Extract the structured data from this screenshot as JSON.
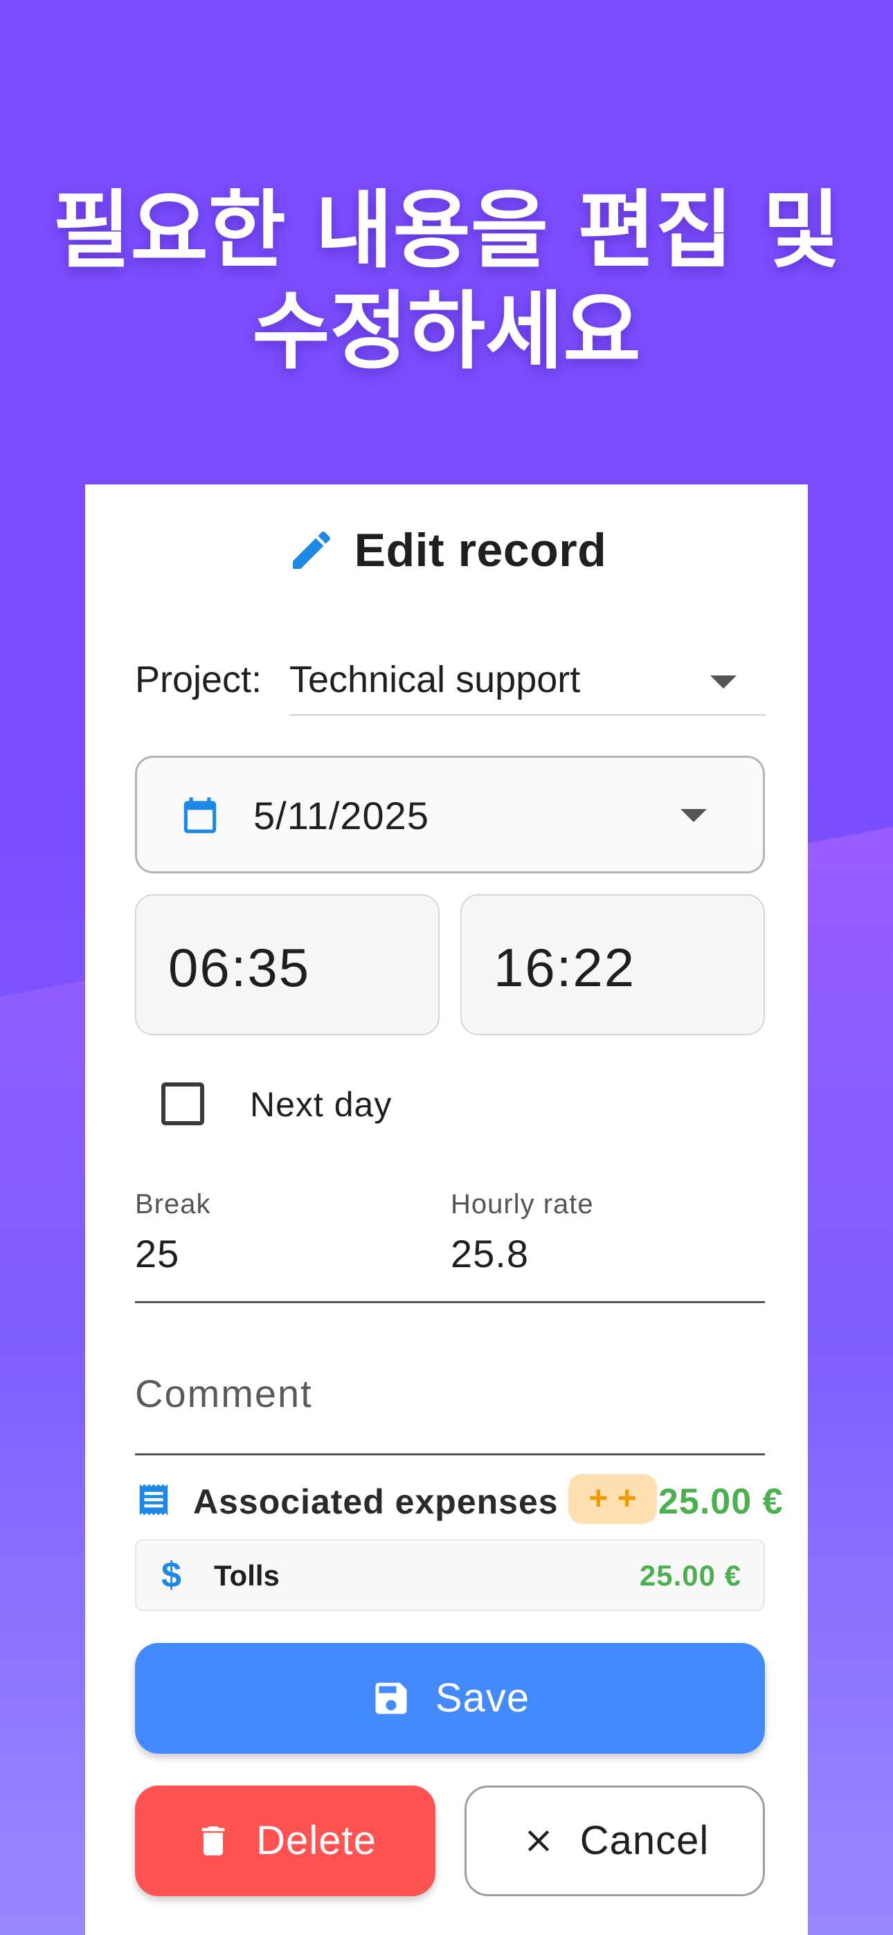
{
  "headline": {
    "line1": "필요한 내용을 편집 및",
    "line2": "수정하세요"
  },
  "dialog": {
    "title": "Edit record",
    "title_icon": "pencil-icon",
    "project": {
      "label": "Project:",
      "value": "Technical support"
    },
    "date": {
      "value": "5/11/2025",
      "icon": "calendar-icon"
    },
    "start_time": "06:35",
    "end_time": "16:22",
    "next_day": {
      "label": "Next day",
      "checked": false
    },
    "break": {
      "label": "Break",
      "value": "25"
    },
    "hourly_rate": {
      "label": "Hourly rate",
      "value": "25.8"
    },
    "comment": {
      "placeholder": "Comment"
    },
    "expenses": {
      "label": "Associated expenses",
      "add_label": "+ +",
      "total": "25.00 €",
      "items": [
        {
          "icon": "dollar-icon",
          "symbol": "$",
          "name": "Tolls",
          "amount": "25.00 €"
        }
      ]
    },
    "buttons": {
      "save": "Save",
      "delete": "Delete",
      "cancel": "Cancel"
    }
  },
  "colors": {
    "background": "#7c4dff",
    "accent_blue": "#448aff",
    "delete_red": "#ff5252",
    "money_green": "#4caf50",
    "add_orange": "#f29a00"
  }
}
